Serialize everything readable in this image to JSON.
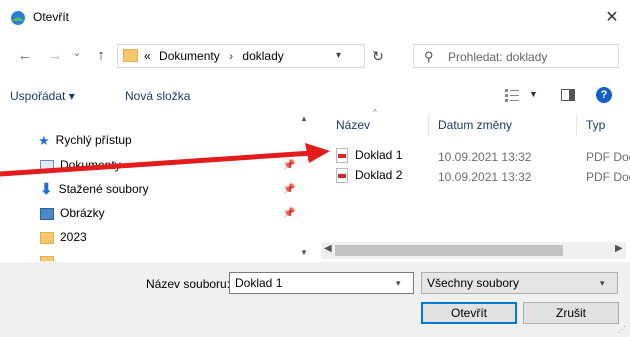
{
  "window": {
    "title": "Otevřít",
    "close_glyph": "✕"
  },
  "nav": {
    "back_glyph": "←",
    "forward_glyph": "→",
    "recent_glyph": "⌄",
    "up_glyph": "↑",
    "breadcrumb_prefix": "«",
    "breadcrumb": [
      "Dokumenty",
      "doklady"
    ],
    "breadcrumb_sep": "›",
    "refresh_glyph": "↻",
    "search_placeholder": "Prohledat: doklady"
  },
  "toolbar": {
    "organize_label": "Uspořádat ▾",
    "new_folder_label": "Nová složka"
  },
  "left_pane": {
    "items": [
      {
        "label": "Rychlý přístup",
        "icon": "star-icon"
      },
      {
        "label": "Dokumenty",
        "icon": "documents-icon",
        "pinned": true
      },
      {
        "label": "Stažené soubory",
        "icon": "download-icon",
        "pinned": true
      },
      {
        "label": "Obrázky",
        "icon": "pictures-icon",
        "pinned": true
      },
      {
        "label": "2023",
        "icon": "folder-icon"
      }
    ]
  },
  "file_list": {
    "columns": [
      "Název",
      "Datum změny",
      "Typ"
    ],
    "rows": [
      {
        "name": "Doklad 1",
        "date": "10.09.2021 13:32",
        "type": "PDF Doc"
      },
      {
        "name": "Doklad 2",
        "date": "10.09.2021 13:32",
        "type": "PDF Doc"
      }
    ]
  },
  "bottom": {
    "filename_label": "Název souboru:",
    "filename_value": "Doklad 1",
    "filter_value": "Všechny soubory",
    "open_label": "Otevřít",
    "cancel_label": "Zrušit"
  },
  "colors": {
    "accent": "#0078d7",
    "arrow": "#e31b1b",
    "folder": "#f5c96a"
  }
}
